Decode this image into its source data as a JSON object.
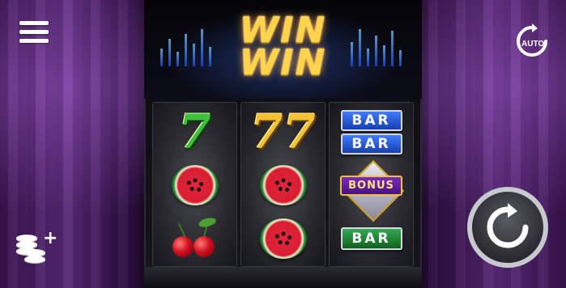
{
  "logo": {
    "line1": "WIN",
    "line2": "WIN"
  },
  "controls": {
    "menu_icon": "hamburger-menu-icon",
    "coins_icon": "coins-plus-icon",
    "coins_plus": "+",
    "auto_label": "AUTO",
    "spin_icon": "refresh-icon"
  },
  "reels": [
    [
      {
        "type": "seven-green",
        "label": "7"
      },
      {
        "type": "watermelon"
      },
      {
        "type": "cherries"
      }
    ],
    [
      {
        "type": "seven-gold",
        "label": "77"
      },
      {
        "type": "watermelon"
      },
      {
        "type": "watermelon"
      }
    ],
    [
      {
        "type": "double-bar",
        "labels": [
          "BAR",
          "BAR"
        ]
      },
      {
        "type": "bonus",
        "label": "BONUS"
      },
      {
        "type": "single-bar",
        "label": "BAR"
      }
    ]
  ],
  "colors": {
    "logo_gold": "#ffd34a",
    "seven_green": "#3fc03a",
    "seven_gold": "#f2c230",
    "bar_blue": "#3f7cff",
    "bar_green": "#32a850",
    "bonus_purple": "#7a2ac0"
  }
}
